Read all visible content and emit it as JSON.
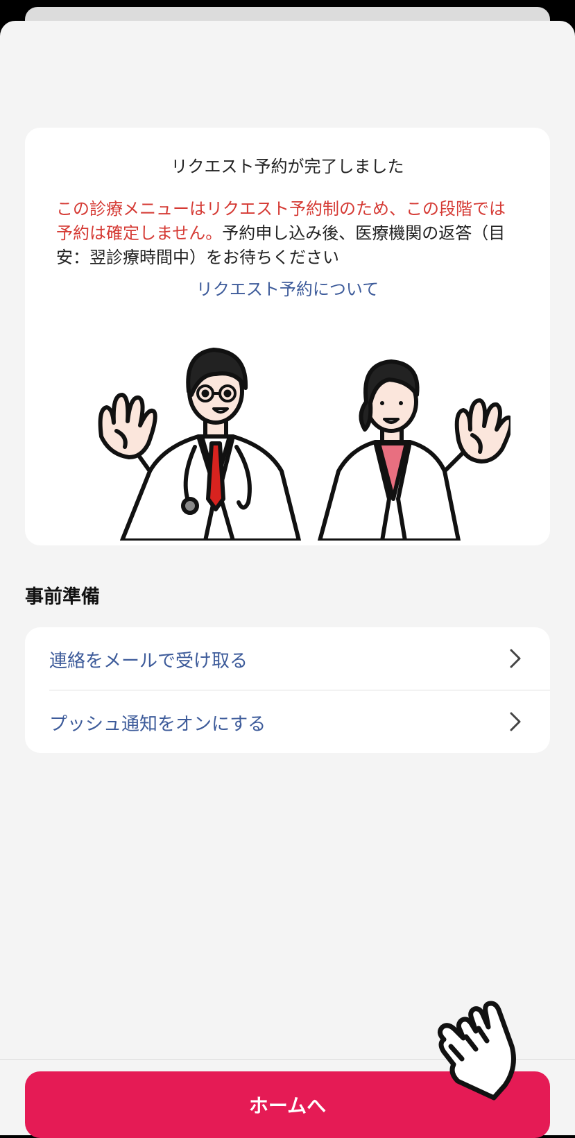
{
  "completion_card": {
    "title": "リクエスト予約が完了しました",
    "notice_red": "この診療メニューはリクエスト予約制のため、この段階では予約は確定しません。",
    "notice_body": "予約申し込み後、医療機関の返答（目安：翌診療時間中）をお待ちください",
    "about_link": "リクエスト予約について",
    "illustration": "two-doctors-waving"
  },
  "preparation": {
    "title": "事前準備",
    "items": [
      {
        "label": "連絡をメールで受け取る",
        "icon": "chevron-right-icon"
      },
      {
        "label": "プッシュ通知をオンにする",
        "icon": "chevron-right-icon"
      }
    ]
  },
  "footer": {
    "home_button": "ホームへ"
  },
  "overlay": {
    "icon": "pointing-hand-icon"
  },
  "colors": {
    "accent": "#e51b55",
    "link": "#3d5b9a",
    "warning_text": "#d53a34",
    "background": "#f4f4f4"
  }
}
